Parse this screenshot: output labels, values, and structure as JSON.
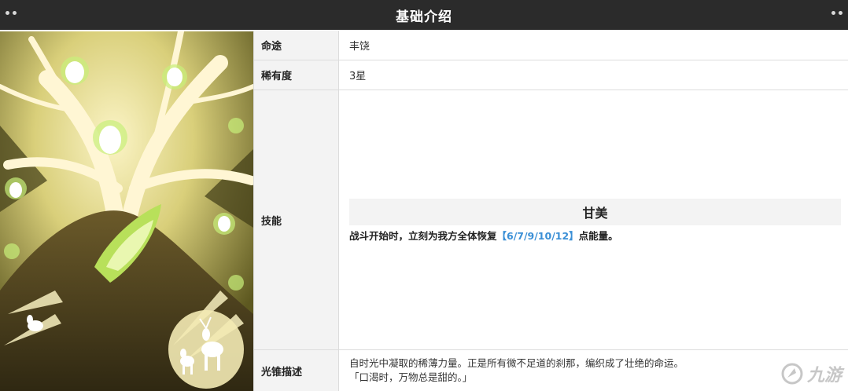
{
  "header": {
    "title": "基础介绍"
  },
  "rows": {
    "path": {
      "label": "命途",
      "value": "丰饶"
    },
    "rarity": {
      "label": "稀有度",
      "value": "3星"
    },
    "skill": {
      "label": "技能",
      "name": "甘美",
      "desc_prefix": "战斗开始时，立刻为我方全体恢复",
      "desc_highlight": "【6/7/9/10/12】",
      "desc_suffix": "点能量。"
    },
    "description": {
      "label": "光锥描述",
      "line1": "自时光中凝取的稀薄力量。正是所有微不足道的刹那，编织成了壮绝的命运。",
      "line2": "「口渴时，万物总是甜的。」"
    }
  },
  "watermark": {
    "text": "九游"
  },
  "colors": {
    "header_bg": "#2b2b2b",
    "label_bg": "#f3f3f3",
    "highlight": "#3a8fd6",
    "border": "#dcdcdc"
  },
  "icons": {
    "art": "light-cone-artwork",
    "watermark_logo": "jiuyou-logo-icon"
  }
}
